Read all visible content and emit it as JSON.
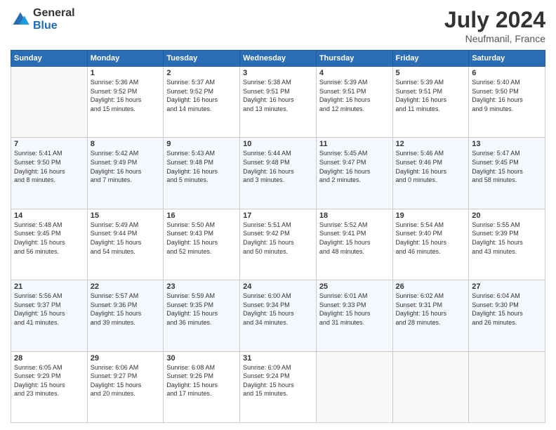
{
  "logo": {
    "general": "General",
    "blue": "Blue"
  },
  "title": {
    "month": "July 2024",
    "location": "Neufmanil, France"
  },
  "headers": [
    "Sunday",
    "Monday",
    "Tuesday",
    "Wednesday",
    "Thursday",
    "Friday",
    "Saturday"
  ],
  "weeks": [
    [
      {
        "day": "",
        "info": ""
      },
      {
        "day": "1",
        "info": "Sunrise: 5:36 AM\nSunset: 9:52 PM\nDaylight: 16 hours\nand 15 minutes."
      },
      {
        "day": "2",
        "info": "Sunrise: 5:37 AM\nSunset: 9:52 PM\nDaylight: 16 hours\nand 14 minutes."
      },
      {
        "day": "3",
        "info": "Sunrise: 5:38 AM\nSunset: 9:51 PM\nDaylight: 16 hours\nand 13 minutes."
      },
      {
        "day": "4",
        "info": "Sunrise: 5:39 AM\nSunset: 9:51 PM\nDaylight: 16 hours\nand 12 minutes."
      },
      {
        "day": "5",
        "info": "Sunrise: 5:39 AM\nSunset: 9:51 PM\nDaylight: 16 hours\nand 11 minutes."
      },
      {
        "day": "6",
        "info": "Sunrise: 5:40 AM\nSunset: 9:50 PM\nDaylight: 16 hours\nand 9 minutes."
      }
    ],
    [
      {
        "day": "7",
        "info": "Sunrise: 5:41 AM\nSunset: 9:50 PM\nDaylight: 16 hours\nand 8 minutes."
      },
      {
        "day": "8",
        "info": "Sunrise: 5:42 AM\nSunset: 9:49 PM\nDaylight: 16 hours\nand 7 minutes."
      },
      {
        "day": "9",
        "info": "Sunrise: 5:43 AM\nSunset: 9:48 PM\nDaylight: 16 hours\nand 5 minutes."
      },
      {
        "day": "10",
        "info": "Sunrise: 5:44 AM\nSunset: 9:48 PM\nDaylight: 16 hours\nand 3 minutes."
      },
      {
        "day": "11",
        "info": "Sunrise: 5:45 AM\nSunset: 9:47 PM\nDaylight: 16 hours\nand 2 minutes."
      },
      {
        "day": "12",
        "info": "Sunrise: 5:46 AM\nSunset: 9:46 PM\nDaylight: 16 hours\nand 0 minutes."
      },
      {
        "day": "13",
        "info": "Sunrise: 5:47 AM\nSunset: 9:45 PM\nDaylight: 15 hours\nand 58 minutes."
      }
    ],
    [
      {
        "day": "14",
        "info": "Sunrise: 5:48 AM\nSunset: 9:45 PM\nDaylight: 15 hours\nand 56 minutes."
      },
      {
        "day": "15",
        "info": "Sunrise: 5:49 AM\nSunset: 9:44 PM\nDaylight: 15 hours\nand 54 minutes."
      },
      {
        "day": "16",
        "info": "Sunrise: 5:50 AM\nSunset: 9:43 PM\nDaylight: 15 hours\nand 52 minutes."
      },
      {
        "day": "17",
        "info": "Sunrise: 5:51 AM\nSunset: 9:42 PM\nDaylight: 15 hours\nand 50 minutes."
      },
      {
        "day": "18",
        "info": "Sunrise: 5:52 AM\nSunset: 9:41 PM\nDaylight: 15 hours\nand 48 minutes."
      },
      {
        "day": "19",
        "info": "Sunrise: 5:54 AM\nSunset: 9:40 PM\nDaylight: 15 hours\nand 46 minutes."
      },
      {
        "day": "20",
        "info": "Sunrise: 5:55 AM\nSunset: 9:39 PM\nDaylight: 15 hours\nand 43 minutes."
      }
    ],
    [
      {
        "day": "21",
        "info": "Sunrise: 5:56 AM\nSunset: 9:37 PM\nDaylight: 15 hours\nand 41 minutes."
      },
      {
        "day": "22",
        "info": "Sunrise: 5:57 AM\nSunset: 9:36 PM\nDaylight: 15 hours\nand 39 minutes."
      },
      {
        "day": "23",
        "info": "Sunrise: 5:59 AM\nSunset: 9:35 PM\nDaylight: 15 hours\nand 36 minutes."
      },
      {
        "day": "24",
        "info": "Sunrise: 6:00 AM\nSunset: 9:34 PM\nDaylight: 15 hours\nand 34 minutes."
      },
      {
        "day": "25",
        "info": "Sunrise: 6:01 AM\nSunset: 9:33 PM\nDaylight: 15 hours\nand 31 minutes."
      },
      {
        "day": "26",
        "info": "Sunrise: 6:02 AM\nSunset: 9:31 PM\nDaylight: 15 hours\nand 28 minutes."
      },
      {
        "day": "27",
        "info": "Sunrise: 6:04 AM\nSunset: 9:30 PM\nDaylight: 15 hours\nand 26 minutes."
      }
    ],
    [
      {
        "day": "28",
        "info": "Sunrise: 6:05 AM\nSunset: 9:29 PM\nDaylight: 15 hours\nand 23 minutes."
      },
      {
        "day": "29",
        "info": "Sunrise: 6:06 AM\nSunset: 9:27 PM\nDaylight: 15 hours\nand 20 minutes."
      },
      {
        "day": "30",
        "info": "Sunrise: 6:08 AM\nSunset: 9:26 PM\nDaylight: 15 hours\nand 17 minutes."
      },
      {
        "day": "31",
        "info": "Sunrise: 6:09 AM\nSunset: 9:24 PM\nDaylight: 15 hours\nand 15 minutes."
      },
      {
        "day": "",
        "info": ""
      },
      {
        "day": "",
        "info": ""
      },
      {
        "day": "",
        "info": ""
      }
    ]
  ]
}
